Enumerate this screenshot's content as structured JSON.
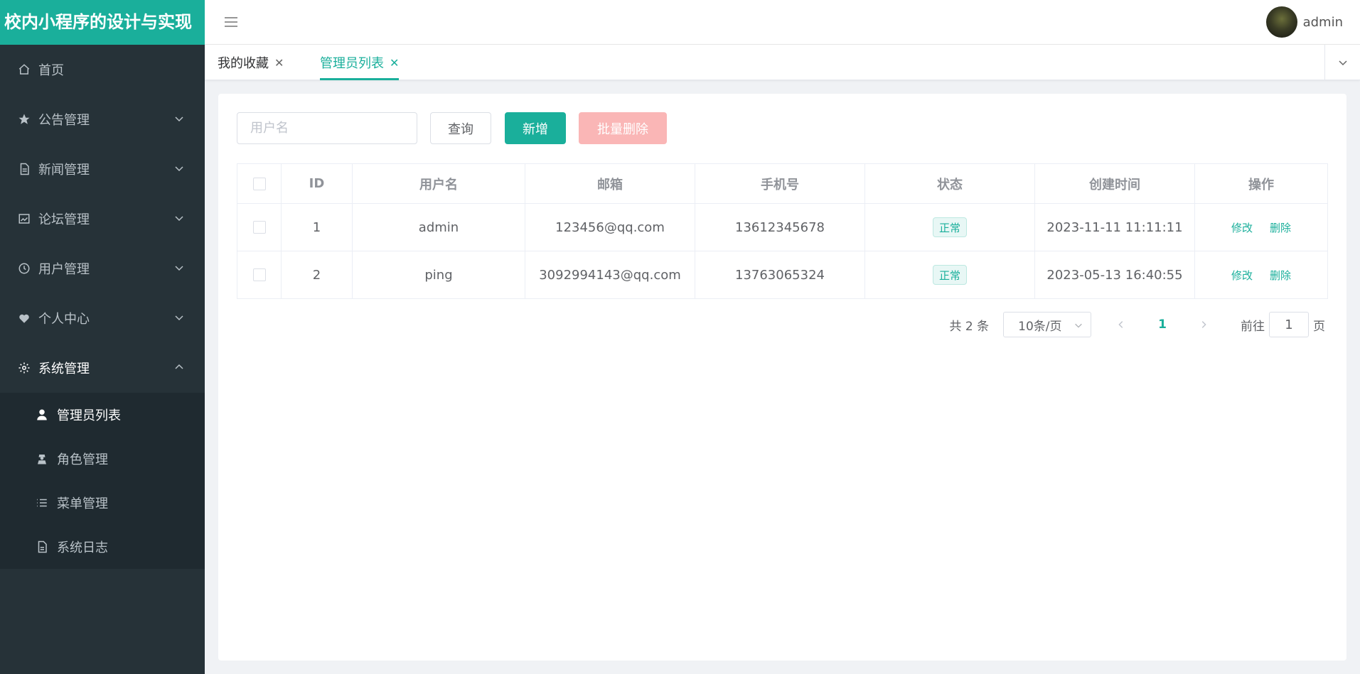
{
  "app": {
    "title": "校内小程序的设计与实现"
  },
  "sidebar": {
    "items": [
      {
        "label": "首页",
        "icon": "home-icon",
        "expandable": false
      },
      {
        "label": "公告管理",
        "icon": "star-icon",
        "expandable": true
      },
      {
        "label": "新闻管理",
        "icon": "document-icon",
        "expandable": true
      },
      {
        "label": "论坛管理",
        "icon": "picture-icon",
        "expandable": true
      },
      {
        "label": "用户管理",
        "icon": "clock-icon",
        "expandable": true
      },
      {
        "label": "个人中心",
        "icon": "heart-icon",
        "expandable": true
      },
      {
        "label": "系统管理",
        "icon": "gear-icon",
        "expandable": true,
        "open": true
      }
    ],
    "submenu": [
      {
        "label": "管理员列表",
        "icon": "user-icon",
        "active": true
      },
      {
        "label": "角色管理",
        "icon": "agent-icon"
      },
      {
        "label": "菜单管理",
        "icon": "list-icon"
      },
      {
        "label": "系统日志",
        "icon": "log-icon"
      }
    ]
  },
  "header": {
    "username": "admin"
  },
  "tabs": [
    {
      "label": "我的收藏",
      "active": false
    },
    {
      "label": "管理员列表",
      "active": true
    }
  ],
  "toolbar": {
    "search_placeholder": "用户名",
    "query_label": "查询",
    "add_label": "新增",
    "batch_delete_label": "批量删除"
  },
  "table": {
    "columns": [
      "ID",
      "用户名",
      "邮箱",
      "手机号",
      "状态",
      "创建时间",
      "操作"
    ],
    "rows": [
      {
        "id": "1",
        "username": "admin",
        "email": "123456@qq.com",
        "phone": "13612345678",
        "status": "正常",
        "created": "2023-11-11 11:11:11"
      },
      {
        "id": "2",
        "username": "ping",
        "email": "3092994143@qq.com",
        "phone": "13763065324",
        "status": "正常",
        "created": "2023-05-13 16:40:55"
      }
    ],
    "edit_label": "修改",
    "delete_label": "删除"
  },
  "pagination": {
    "total_text": "共 2 条",
    "page_size": "10条/页",
    "current_page": "1",
    "goto_prefix": "前往",
    "goto_value": "1",
    "goto_suffix": "页"
  },
  "colors": {
    "accent": "#1aaf9b",
    "sidebar_bg": "#263238",
    "danger_light": "#fab6b6"
  }
}
